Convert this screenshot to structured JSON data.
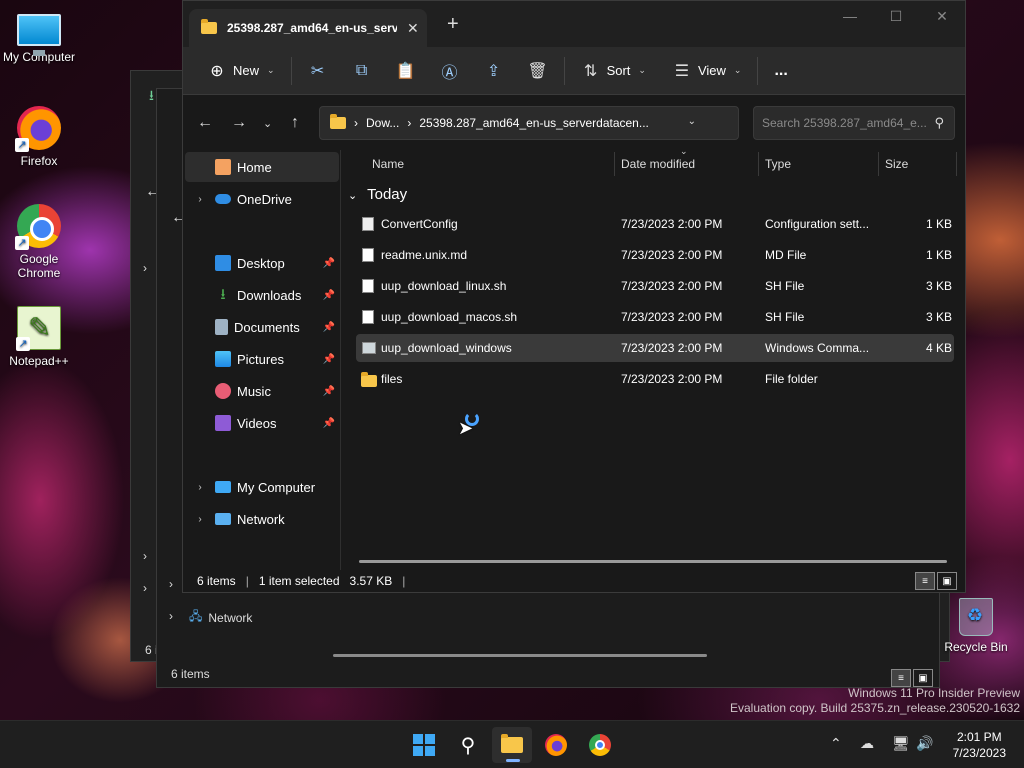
{
  "desktop": {
    "icons": [
      {
        "label": "My Computer"
      },
      {
        "label": "Firefox"
      },
      {
        "label": "Google Chrome"
      },
      {
        "label": "Notepad++"
      }
    ],
    "recycle_bin": "Recycle Bin",
    "watermark_line1": "Windows 11 Pro Insider Preview",
    "watermark_line2": "Evaluation copy. Build 25375.zn_release.230520-1632"
  },
  "bg_window": {
    "network_label": "Network",
    "status_items": "6 items",
    "status_items_partial": "6 i"
  },
  "window": {
    "tab_title": "25398.287_amd64_en-us_serv",
    "toolbar": {
      "new_label": "New",
      "sort_label": "Sort",
      "view_label": "View",
      "more_label": "..."
    },
    "address": {
      "crumb1": "Dow...",
      "crumb2": "25398.287_amd64_en-us_serverdatacen..."
    },
    "search": {
      "placeholder": "Search 25398.287_amd64_e..."
    },
    "nav": {
      "home": "Home",
      "onedrive": "OneDrive",
      "desktop": "Desktop",
      "downloads": "Downloads",
      "documents": "Documents",
      "pictures": "Pictures",
      "music": "Music",
      "videos": "Videos",
      "my_computer": "My Computer",
      "network": "Network"
    },
    "columns": {
      "name": "Name",
      "date": "Date modified",
      "type": "Type",
      "size": "Size"
    },
    "group_label": "Today",
    "files": [
      {
        "name": "ConvertConfig",
        "date": "7/23/2023 2:00 PM",
        "type": "Configuration sett...",
        "size": "1 KB"
      },
      {
        "name": "readme.unix.md",
        "date": "7/23/2023 2:00 PM",
        "type": "MD File",
        "size": "1 KB"
      },
      {
        "name": "uup_download_linux.sh",
        "date": "7/23/2023 2:00 PM",
        "type": "SH File",
        "size": "3 KB"
      },
      {
        "name": "uup_download_macos.sh",
        "date": "7/23/2023 2:00 PM",
        "type": "SH File",
        "size": "3 KB"
      },
      {
        "name": "uup_download_windows",
        "date": "7/23/2023 2:00 PM",
        "type": "Windows Comma...",
        "size": "4 KB"
      },
      {
        "name": "files",
        "date": "7/23/2023 2:00 PM",
        "type": "File folder",
        "size": ""
      }
    ],
    "status": {
      "count": "6 items",
      "selection": "1 item selected",
      "selection_size": "3.57 KB"
    }
  },
  "taskbar": {
    "time": "2:01 PM",
    "date": "7/23/2023"
  },
  "colors": {
    "accent": "#3fa9f5",
    "folder": "#f8c64a",
    "window_bg": "#191919"
  }
}
